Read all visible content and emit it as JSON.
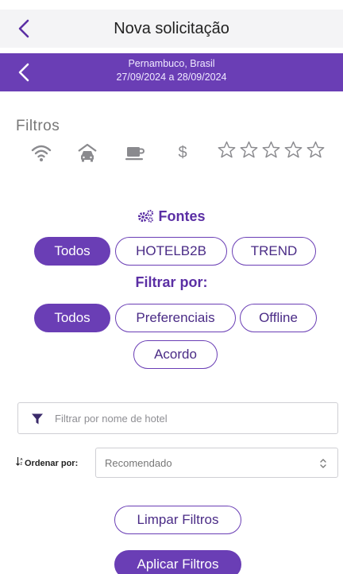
{
  "header": {
    "title": "Nova solicitação"
  },
  "trip": {
    "location": "Pernambuco, Brasil",
    "dates": "27/09/2024 a 28/09/2024"
  },
  "filters": {
    "label": "Filtros",
    "amenities": [
      "wifi-icon",
      "car-icon",
      "coffee-icon",
      "price-icon"
    ],
    "price_symbol": "$",
    "stars": 0,
    "star_count": 5
  },
  "sources": {
    "title": "Fontes",
    "options": [
      "Todos",
      "HOTELB2B",
      "TREND"
    ],
    "selected": "Todos"
  },
  "filter_by": {
    "title": "Filtrar por:",
    "options": [
      "Todos",
      "Preferenciais",
      "Offline",
      "Acordo"
    ],
    "selected": "Todos"
  },
  "hotel_search": {
    "placeholder": "Filtrar por nome de hotel"
  },
  "order": {
    "label": "Ordenar por:",
    "value": "Recomendado"
  },
  "buttons": {
    "clear": "Limpar Filtros",
    "apply": "Aplicar Filtros"
  },
  "colors": {
    "accent": "#6a3eb5",
    "icon_gray": "#8a8a8e"
  }
}
